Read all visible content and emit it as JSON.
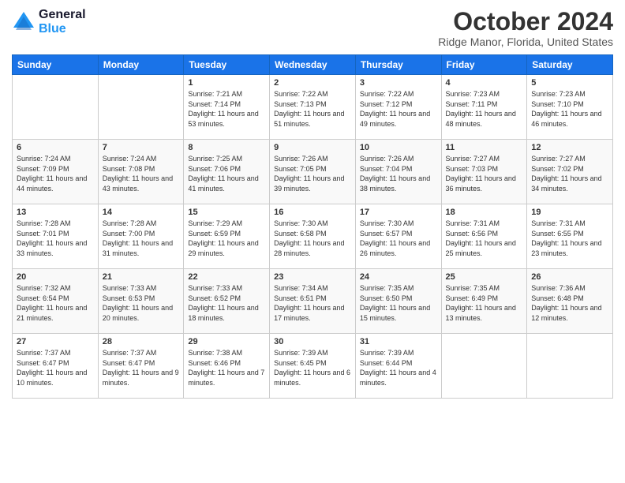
{
  "header": {
    "logo_line1": "General",
    "logo_line2": "Blue",
    "month_title": "October 2024",
    "location": "Ridge Manor, Florida, United States"
  },
  "days_of_week": [
    "Sunday",
    "Monday",
    "Tuesday",
    "Wednesday",
    "Thursday",
    "Friday",
    "Saturday"
  ],
  "weeks": [
    [
      {
        "day": "",
        "info": ""
      },
      {
        "day": "",
        "info": ""
      },
      {
        "day": "1",
        "info": "Sunrise: 7:21 AM\nSunset: 7:14 PM\nDaylight: 11 hours and 53 minutes."
      },
      {
        "day": "2",
        "info": "Sunrise: 7:22 AM\nSunset: 7:13 PM\nDaylight: 11 hours and 51 minutes."
      },
      {
        "day": "3",
        "info": "Sunrise: 7:22 AM\nSunset: 7:12 PM\nDaylight: 11 hours and 49 minutes."
      },
      {
        "day": "4",
        "info": "Sunrise: 7:23 AM\nSunset: 7:11 PM\nDaylight: 11 hours and 48 minutes."
      },
      {
        "day": "5",
        "info": "Sunrise: 7:23 AM\nSunset: 7:10 PM\nDaylight: 11 hours and 46 minutes."
      }
    ],
    [
      {
        "day": "6",
        "info": "Sunrise: 7:24 AM\nSunset: 7:09 PM\nDaylight: 11 hours and 44 minutes."
      },
      {
        "day": "7",
        "info": "Sunrise: 7:24 AM\nSunset: 7:08 PM\nDaylight: 11 hours and 43 minutes."
      },
      {
        "day": "8",
        "info": "Sunrise: 7:25 AM\nSunset: 7:06 PM\nDaylight: 11 hours and 41 minutes."
      },
      {
        "day": "9",
        "info": "Sunrise: 7:26 AM\nSunset: 7:05 PM\nDaylight: 11 hours and 39 minutes."
      },
      {
        "day": "10",
        "info": "Sunrise: 7:26 AM\nSunset: 7:04 PM\nDaylight: 11 hours and 38 minutes."
      },
      {
        "day": "11",
        "info": "Sunrise: 7:27 AM\nSunset: 7:03 PM\nDaylight: 11 hours and 36 minutes."
      },
      {
        "day": "12",
        "info": "Sunrise: 7:27 AM\nSunset: 7:02 PM\nDaylight: 11 hours and 34 minutes."
      }
    ],
    [
      {
        "day": "13",
        "info": "Sunrise: 7:28 AM\nSunset: 7:01 PM\nDaylight: 11 hours and 33 minutes."
      },
      {
        "day": "14",
        "info": "Sunrise: 7:28 AM\nSunset: 7:00 PM\nDaylight: 11 hours and 31 minutes."
      },
      {
        "day": "15",
        "info": "Sunrise: 7:29 AM\nSunset: 6:59 PM\nDaylight: 11 hours and 29 minutes."
      },
      {
        "day": "16",
        "info": "Sunrise: 7:30 AM\nSunset: 6:58 PM\nDaylight: 11 hours and 28 minutes."
      },
      {
        "day": "17",
        "info": "Sunrise: 7:30 AM\nSunset: 6:57 PM\nDaylight: 11 hours and 26 minutes."
      },
      {
        "day": "18",
        "info": "Sunrise: 7:31 AM\nSunset: 6:56 PM\nDaylight: 11 hours and 25 minutes."
      },
      {
        "day": "19",
        "info": "Sunrise: 7:31 AM\nSunset: 6:55 PM\nDaylight: 11 hours and 23 minutes."
      }
    ],
    [
      {
        "day": "20",
        "info": "Sunrise: 7:32 AM\nSunset: 6:54 PM\nDaylight: 11 hours and 21 minutes."
      },
      {
        "day": "21",
        "info": "Sunrise: 7:33 AM\nSunset: 6:53 PM\nDaylight: 11 hours and 20 minutes."
      },
      {
        "day": "22",
        "info": "Sunrise: 7:33 AM\nSunset: 6:52 PM\nDaylight: 11 hours and 18 minutes."
      },
      {
        "day": "23",
        "info": "Sunrise: 7:34 AM\nSunset: 6:51 PM\nDaylight: 11 hours and 17 minutes."
      },
      {
        "day": "24",
        "info": "Sunrise: 7:35 AM\nSunset: 6:50 PM\nDaylight: 11 hours and 15 minutes."
      },
      {
        "day": "25",
        "info": "Sunrise: 7:35 AM\nSunset: 6:49 PM\nDaylight: 11 hours and 13 minutes."
      },
      {
        "day": "26",
        "info": "Sunrise: 7:36 AM\nSunset: 6:48 PM\nDaylight: 11 hours and 12 minutes."
      }
    ],
    [
      {
        "day": "27",
        "info": "Sunrise: 7:37 AM\nSunset: 6:47 PM\nDaylight: 11 hours and 10 minutes."
      },
      {
        "day": "28",
        "info": "Sunrise: 7:37 AM\nSunset: 6:47 PM\nDaylight: 11 hours and 9 minutes."
      },
      {
        "day": "29",
        "info": "Sunrise: 7:38 AM\nSunset: 6:46 PM\nDaylight: 11 hours and 7 minutes."
      },
      {
        "day": "30",
        "info": "Sunrise: 7:39 AM\nSunset: 6:45 PM\nDaylight: 11 hours and 6 minutes."
      },
      {
        "day": "31",
        "info": "Sunrise: 7:39 AM\nSunset: 6:44 PM\nDaylight: 11 hours and 4 minutes."
      },
      {
        "day": "",
        "info": ""
      },
      {
        "day": "",
        "info": ""
      }
    ]
  ]
}
